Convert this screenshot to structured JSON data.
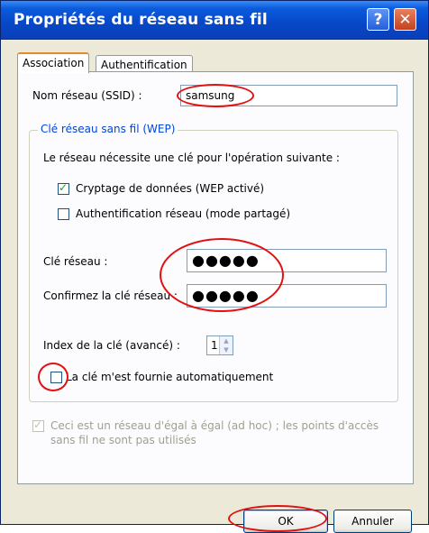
{
  "window": {
    "title": "Propriétés du réseau sans fil",
    "help_label": "?",
    "close_label": "✕"
  },
  "tabs": [
    {
      "label": "Association",
      "active": true
    },
    {
      "label": "Authentification",
      "active": false
    }
  ],
  "ssid": {
    "label": "Nom réseau (SSID) :",
    "value": "samsung"
  },
  "wep_group": {
    "legend": "Clé réseau sans fil (WEP)",
    "description": "Le réseau nécessite une clé pour l'opération suivante :",
    "encryption": {
      "label": "Cryptage de données (WEP activé)",
      "checked": true
    },
    "shared_auth": {
      "label": "Authentification réseau (mode partagé)",
      "checked": false
    },
    "network_key": {
      "label": "Clé réseau :",
      "value": "●●●●●"
    },
    "confirm_key": {
      "label": "Confirmez la clé réseau :",
      "value": "●●●●●"
    },
    "key_index": {
      "label": "Index de la clé (avancé) :",
      "value": "1"
    },
    "auto_key": {
      "label": "La clé m'est fournie automatiquement",
      "checked": false
    }
  },
  "adhoc": {
    "line1": "Ceci est un réseau d'égal à égal (ad hoc) ; les points d'accès",
    "line2": "sans fil ne sont pas utilisés",
    "checked": true
  },
  "buttons": {
    "ok": "OK",
    "cancel": "Annuler"
  },
  "colors": {
    "annotation": "#e21010",
    "titlebar": "#0a5bdc",
    "group_legend": "#0046d5"
  }
}
